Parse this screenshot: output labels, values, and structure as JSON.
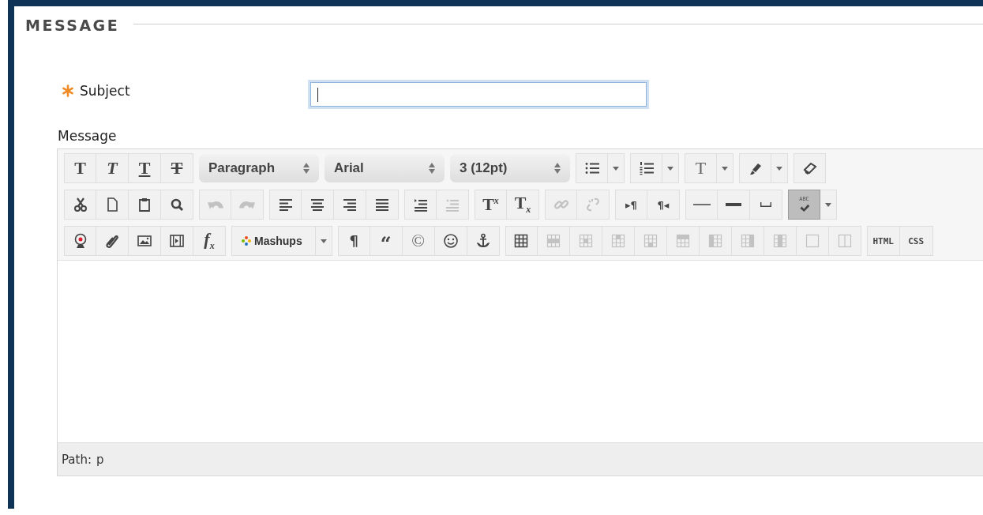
{
  "section_title": "MESSAGE",
  "subject": {
    "label": "Subject",
    "required": true,
    "focused": true
  },
  "message_label": "Message",
  "toolbar": [
    {
      "groups": [
        {
          "items": [
            {
              "kind": "button",
              "text": "T",
              "disabled": false,
              "pressed": false
            },
            {
              "kind": "button",
              "text": "T",
              "disabled": false,
              "pressed": false
            },
            {
              "kind": "button",
              "text": "T",
              "disabled": false,
              "pressed": false
            },
            {
              "kind": "button",
              "text": "T",
              "disabled": false,
              "pressed": false
            }
          ]
        },
        {
          "items": [
            {
              "kind": "select",
              "value": "Paragraph"
            }
          ]
        },
        {
          "items": [
            {
              "kind": "select",
              "value": "Arial"
            }
          ]
        },
        {
          "items": [
            {
              "kind": "select",
              "value": "3 (12pt)"
            }
          ]
        },
        {
          "items": [
            {
              "kind": "split-button",
              "disabled": false,
              "pressed": false
            }
          ]
        },
        {
          "items": [
            {
              "kind": "split-button",
              "disabled": false,
              "pressed": false
            }
          ]
        },
        {
          "items": [
            {
              "kind": "split-button",
              "text": "T",
              "disabled": false,
              "pressed": false
            }
          ]
        },
        {
          "items": [
            {
              "kind": "split-button",
              "disabled": false,
              "pressed": false
            }
          ]
        },
        {
          "items": [
            {
              "kind": "button",
              "disabled": false,
              "pressed": false
            }
          ]
        }
      ]
    },
    {
      "groups": [
        {
          "items": [
            {
              "kind": "button",
              "disabled": false,
              "pressed": false
            },
            {
              "kind": "button",
              "disabled": false,
              "pressed": false
            },
            {
              "kind": "button",
              "disabled": false,
              "pressed": false
            },
            {
              "kind": "button",
              "disabled": false,
              "pressed": false
            }
          ]
        },
        {
          "items": [
            {
              "kind": "button",
              "disabled": true,
              "pressed": false
            },
            {
              "kind": "button",
              "disabled": true,
              "pressed": false
            }
          ]
        },
        {
          "items": [
            {
              "kind": "button",
              "disabled": false,
              "pressed": false
            },
            {
              "kind": "button",
              "disabled": false,
              "pressed": false
            },
            {
              "kind": "button",
              "disabled": false,
              "pressed": false
            },
            {
              "kind": "button",
              "disabled": false,
              "pressed": false
            }
          ]
        },
        {
          "items": [
            {
              "kind": "button",
              "disabled": false,
              "pressed": false
            },
            {
              "kind": "button",
              "disabled": true,
              "pressed": false
            }
          ]
        },
        {
          "items": [
            {
              "kind": "button",
              "text": "T$^{x}$",
              "disabled": false,
              "pressed": false
            },
            {
              "kind": "button",
              "text": "T$_{x}$",
              "disabled": false,
              "pressed": false
            }
          ]
        },
        {
          "items": [
            {
              "kind": "button",
              "disabled": true,
              "pressed": false
            },
            {
              "kind": "button",
              "disabled": true,
              "pressed": false
            }
          ]
        },
        {
          "items": [
            {
              "kind": "button",
              "text": "▸¶",
              "disabled": false,
              "pressed": false
            },
            {
              "kind": "button",
              "text": "¶◂",
              "disabled": false,
              "pressed": false
            }
          ]
        },
        {
          "items": [
            {
              "kind": "button",
              "disabled": false,
              "pressed": false
            },
            {
              "kind": "button",
              "disabled": false,
              "pressed": false
            },
            {
              "kind": "button",
              "disabled": false,
              "pressed": false
            }
          ]
        },
        {
          "items": [
            {
              "kind": "split-button",
              "text": "ABC",
              "disabled": false,
              "pressed": true
            }
          ]
        }
      ]
    },
    {
      "groups": [
        {
          "items": [
            {
              "kind": "button",
              "disabled": false,
              "pressed": false
            },
            {
              "kind": "button",
              "disabled": false,
              "pressed": false
            },
            {
              "kind": "button",
              "disabled": false,
              "pressed": false
            },
            {
              "kind": "button",
              "disabled": false,
              "pressed": false
            },
            {
              "kind": "button",
              "text": "f$_{x}$",
              "disabled": false,
              "pressed": false
            }
          ]
        },
        {
          "items": [
            {
              "kind": "menu",
              "label": "Mashups"
            }
          ]
        },
        {
          "items": [
            {
              "kind": "button",
              "text": "¶",
              "disabled": false,
              "pressed": false
            },
            {
              "kind": "button",
              "text": "“",
              "disabled": false,
              "pressed": false
            },
            {
              "kind": "button",
              "text": "©",
              "disabled": false,
              "pressed": false
            },
            {
              "kind": "button",
              "disabled": false,
              "pressed": false
            },
            {
              "kind": "button",
              "disabled": false,
              "pressed": false
            }
          ]
        },
        {
          "items": [
            {
              "kind": "button",
              "disabled": false,
              "pressed": false
            },
            {
              "kind": "button",
              "disabled": true,
              "pressed": false
            },
            {
              "kind": "button",
              "disabled": true,
              "pressed": false
            },
            {
              "kind": "button",
              "disabled": true,
              "pressed": false
            },
            {
              "kind": "button",
              "disabled": true,
              "pressed": false
            },
            {
              "kind": "button",
              "disabled": true,
              "pressed": false
            },
            {
              "kind": "button",
              "disabled": true,
              "pressed": false
            },
            {
              "kind": "button",
              "disabled": true,
              "pressed": false
            },
            {
              "kind": "button",
              "disabled": true,
              "pressed": false
            },
            {
              "kind": "button",
              "disabled": true,
              "pressed": false
            },
            {
              "kind": "button",
              "disabled": true,
              "pressed": false
            }
          ]
        },
        {
          "items": [
            {
              "kind": "label-button",
              "label": "HTML"
            },
            {
              "kind": "label-button",
              "label": "CSS"
            }
          ]
        }
      ]
    }
  ],
  "path_bar": {
    "label": "Path:",
    "value": "p"
  }
}
